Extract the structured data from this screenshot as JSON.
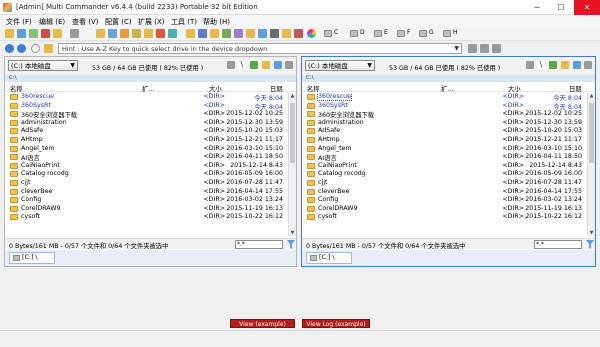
{
  "window": {
    "title": "[Admin] Multi Commander v6.4.4 (build 2233) Portable 32 bit Edition",
    "minimize": "─",
    "maximize": "☐",
    "close": "✕"
  },
  "menu": [
    "文件 (F)",
    "编辑 (E)",
    "查看 (V)",
    "配置 (C)",
    "扩展 (X)",
    "工具 (T)",
    "帮助 (H)"
  ],
  "drives": [
    "C",
    "D",
    "E",
    "F",
    "G",
    "H"
  ],
  "hint": "Hint : Use A-Z Key to quick select drive in the device dropdown",
  "left": {
    "drive": "(C:) 本地磁盘",
    "free": "53 GB / 64 GB 已使用 ( 82% 已使用 )",
    "path": "C:\\",
    "headers": {
      "name": "名称",
      "ext": "扩...",
      "size": "大小",
      "date": "日期"
    },
    "rows": [
      {
        "name": "360rescue",
        "size": "<DIR>",
        "date": "今天 8:04",
        "blue": true
      },
      {
        "name": "360SysRt",
        "size": "<DIR>",
        "date": "今天 8:04",
        "blue": true
      },
      {
        "name": "360安全浏览器下载",
        "size": "<DIR>",
        "date": "2015-12-02 10:25"
      },
      {
        "name": "administration",
        "size": "<DIR>",
        "date": "2015-12-30 13:59"
      },
      {
        "name": "AdSafe",
        "size": "<DIR>",
        "date": "2015-10-20 15:03"
      },
      {
        "name": "AHtmp",
        "size": "<DIR>",
        "date": "2015-12-21 11:17"
      },
      {
        "name": "Angel_tem",
        "size": "<DIR>",
        "date": "2016-03-10 15:10"
      },
      {
        "name": "AI语言",
        "size": "<DIR>",
        "date": "2016-04-11 18:50"
      },
      {
        "name": "CaiNiaoPrint",
        "size": "<DIR>",
        "date": "2015-12-14 8:43"
      },
      {
        "name": "Catalog rocodg",
        "size": "<DIR>",
        "date": "2016-05-09 16:00"
      },
      {
        "name": "cjjt",
        "size": "<DIR>",
        "date": "2016-07-28 11:47"
      },
      {
        "name": "cleverBee",
        "size": "<DIR>",
        "date": "2016-04-14 17:55"
      },
      {
        "name": "Config",
        "size": "<DIR>",
        "date": "2016-03-02 13:24"
      },
      {
        "name": "CorelDRAW9",
        "size": "<DIR>",
        "date": "2015-11-19 16:13"
      },
      {
        "name": "cysoft",
        "size": "<DIR>",
        "date": "2015-10-22 16:12"
      }
    ],
    "status": "0 Bytes/161 MB - 0/57 个文件和 0/64 个文件夹被选中",
    "filter": "*.*",
    "tab": "[C:] \\"
  },
  "right": {
    "drive": "(C:) 本地磁盘",
    "free": "53 GB / 64 GB 已使用 ( 82% 已使用 )",
    "path": "C:\\",
    "headers": {
      "name": "名称",
      "ext": "扩...",
      "size": "大小",
      "date": "日期"
    },
    "rows": [
      {
        "name": "360rescue",
        "size": "<DIR>",
        "date": "今天 8:04",
        "blue": true,
        "selected": true
      },
      {
        "name": "360SysRt",
        "size": "<DIR>",
        "date": "今天 8:04",
        "blue": true
      },
      {
        "name": "360安全浏览器下载",
        "size": "<DIR>",
        "date": "2015-12-02 10:25"
      },
      {
        "name": "administration",
        "size": "<DIR>",
        "date": "2015-12-30 13:59"
      },
      {
        "name": "AdSafe",
        "size": "<DIR>",
        "date": "2015-10-20 15:03"
      },
      {
        "name": "AHtmp",
        "size": "<DIR>",
        "date": "2015-12-21 11:17"
      },
      {
        "name": "Angel_tem",
        "size": "<DIR>",
        "date": "2016-03-10 15:10"
      },
      {
        "name": "AI语言",
        "size": "<DIR>",
        "date": "2016-04-11 18:50"
      },
      {
        "name": "CaiNiaoPrint",
        "size": "<DIR>",
        "date": "2015-12-14 8:43"
      },
      {
        "name": "Catalog rocodg",
        "size": "<DIR>",
        "date": "2016-05-09 16:00"
      },
      {
        "name": "cjjt",
        "size": "<DIR>",
        "date": "2016-07-28 11:47"
      },
      {
        "name": "cleverBee",
        "size": "<DIR>",
        "date": "2016-04-14 17:55"
      },
      {
        "name": "Config",
        "size": "<DIR>",
        "date": "2016-03-02 13:24"
      },
      {
        "name": "CorelDRAW9",
        "size": "<DIR>",
        "date": "2015-11-19 16:13"
      },
      {
        "name": "cysoft",
        "size": "<DIR>",
        "date": "2015-10-22 16:12"
      }
    ],
    "status": "0 Bytes/161 MB - 0/57 个文件和 0/64 个文件夹被选中",
    "filter": "*.*",
    "tab": "[C:] \\"
  },
  "bottom": {
    "view": "View (example)",
    "viewlog": "View Log (example)"
  },
  "colors": {
    "accent": "#3a7bd5",
    "dir_new": "#1a3ad8",
    "folder": "#f2c24f",
    "bottom_button": "#b51d1d"
  }
}
